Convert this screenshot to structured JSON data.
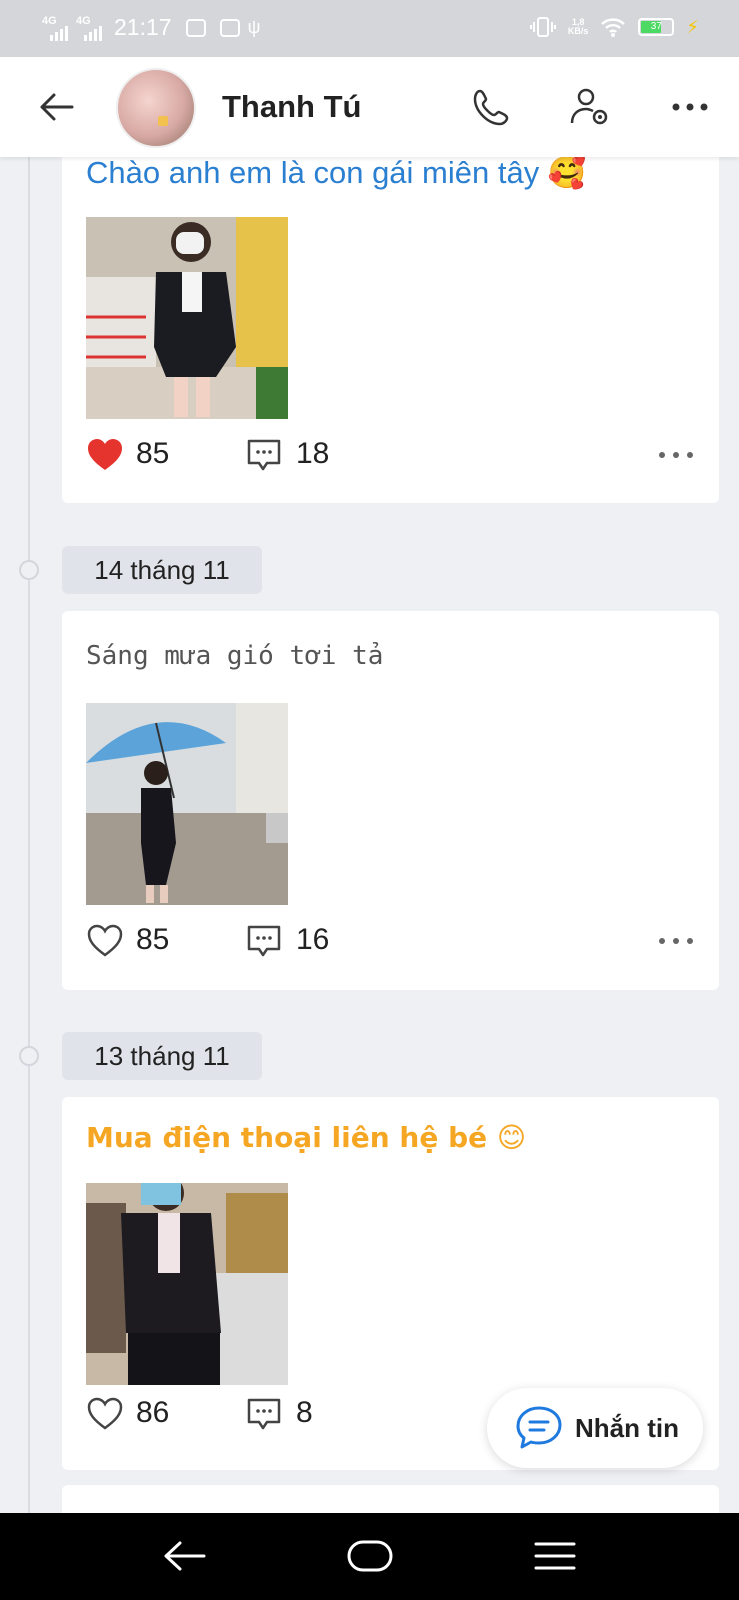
{
  "status_bar": {
    "net1": "4G",
    "net2": "4G",
    "time": "21:17",
    "speed_top": "1,8",
    "speed_bottom": "KB/s",
    "battery": "37"
  },
  "header": {
    "contact_name": "Thanh Tú"
  },
  "posts": [
    {
      "caption": "Chào anh em là con gái miên tây 🥰",
      "likes": "85",
      "comments": "18",
      "liked": true
    },
    {
      "date": "14 tháng 11",
      "caption": "Sáng mưa gió tơi tả",
      "likes": "85",
      "comments": "16",
      "liked": false
    },
    {
      "date": "13 tháng 11",
      "caption": "Mua điện thoại liên hệ bé 😊",
      "likes": "86",
      "comments": "8",
      "liked": false
    }
  ],
  "fab": {
    "label": "Nhắn tin"
  },
  "colors": {
    "caption_blue": "#2b7fd1",
    "caption_orange": "#f5a623",
    "heart_red": "#e5342e"
  }
}
